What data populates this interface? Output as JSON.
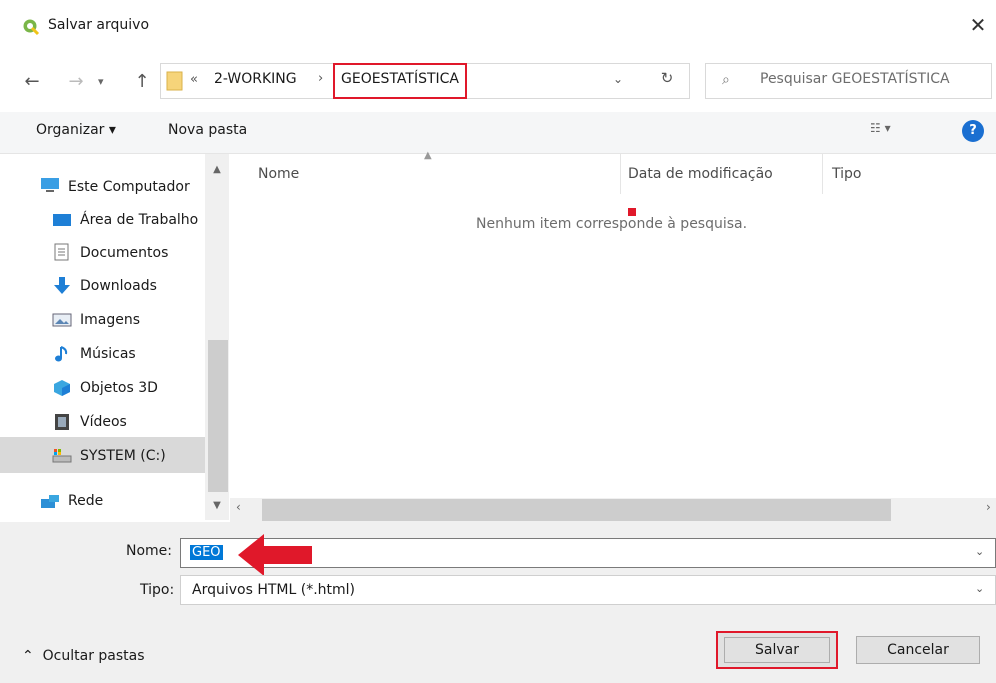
{
  "window": {
    "title": "Salvar arquivo",
    "close_glyph": "✕",
    "app_icon": "qgis-icon"
  },
  "address": {
    "breadcrumb": [
      "2-WORKING",
      "GEOESTATÍSTICA"
    ],
    "overflow_glyph": "«",
    "separator_glyph": "›",
    "search_placeholder": "Pesquisar GEOESTATÍSTICA"
  },
  "toolbar": {
    "organizar_label": "Organizar ▾",
    "nova_pasta_label": "Nova pasta",
    "help_label": "?"
  },
  "nav_pane": {
    "items": [
      {
        "label": "Este Computador",
        "icon": "computer-icon"
      },
      {
        "label": "Área de Trabalho",
        "icon": "desktop-icon"
      },
      {
        "label": "Documentos",
        "icon": "document-icon"
      },
      {
        "label": "Downloads",
        "icon": "download-icon"
      },
      {
        "label": "Imagens",
        "icon": "pictures-icon"
      },
      {
        "label": "Músicas",
        "icon": "music-icon"
      },
      {
        "label": "Objetos 3D",
        "icon": "3d-objects-icon"
      },
      {
        "label": "Vídeos",
        "icon": "videos-icon"
      },
      {
        "label": "SYSTEM (C:)",
        "icon": "drive-icon"
      },
      {
        "label": "Rede",
        "icon": "network-icon"
      }
    ],
    "selected": "SYSTEM (C:)"
  },
  "file_list": {
    "columns": [
      "Nome",
      "Data de modificação",
      "Tipo"
    ],
    "empty_message": "Nenhum item corresponde à pesquisa."
  },
  "form": {
    "nome_label": "Nome:",
    "nome_value": "GEO",
    "tipo_label": "Tipo:",
    "tipo_value": "Arquivos HTML (*.html)"
  },
  "footer": {
    "ocultar_label": "Ocultar pastas",
    "salvar_label": "Salvar",
    "cancelar_label": "Cancelar"
  },
  "colors": {
    "highlight_red": "#e0182a",
    "selection_blue": "#0078d7",
    "help_blue": "#1a6fd1"
  }
}
